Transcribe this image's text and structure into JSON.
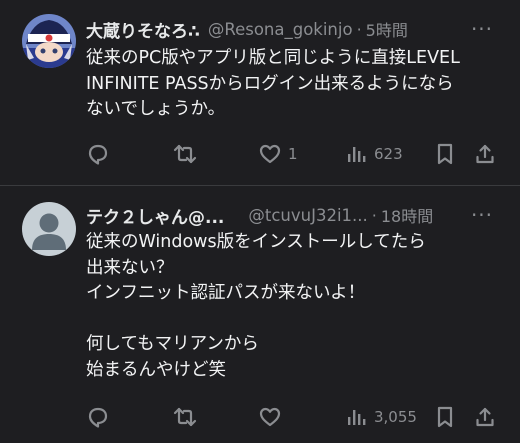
{
  "tweets": [
    {
      "author_name": "大蔵りそなろ∴",
      "handle": "@Resona_gokinjo",
      "separator": "·",
      "time": "5時間",
      "more": "···",
      "text": "従来のPC版やアプリ版と同じように直接LEVEL\nINFINITE PASSからログイン出来るようになら\nないでしょうか。",
      "actions": {
        "reply_count": "",
        "retweet_count": "",
        "like_count": "1",
        "view_count": "623"
      }
    },
    {
      "author_name": "テク２しゃん@...",
      "handle": "@tcuvuJ32i1...",
      "separator": "·",
      "time": "18時間",
      "more": "···",
      "text": "従来のWindows版をインストールしてたら\n出来ない？\nインフニット認証パスが来ないよ！\n\n何してもマリアンから\n始まるんやけど笑",
      "actions": {
        "reply_count": "",
        "retweet_count": "",
        "like_count": "",
        "view_count": "3,055"
      }
    }
  ],
  "icons": {
    "reply": "reply-icon",
    "retweet": "retweet-icon",
    "like": "heart-icon",
    "views": "views-icon",
    "bookmark": "bookmark-icon",
    "share": "share-icon",
    "more": "more-icon"
  },
  "colors": {
    "background": "#1e1e21",
    "text": "#e7e9ea",
    "muted": "#8b8d91",
    "divider": "#3a3b3e"
  }
}
